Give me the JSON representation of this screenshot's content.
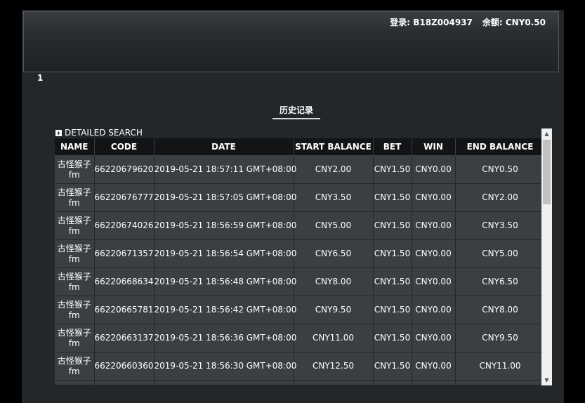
{
  "header": {
    "login_text": "登录: B18Z004937",
    "balance_text": "余额: CNY0.50"
  },
  "pagination": {
    "current_page": "1"
  },
  "tabs": [
    {
      "label": "历史记录"
    }
  ],
  "search": {
    "label": "DETAILED SEARCH"
  },
  "table": {
    "columns": [
      "NAME",
      "CODE",
      "DATE",
      "START BALANCE",
      "BET",
      "WIN",
      "END BALANCE"
    ],
    "rows": [
      {
        "name_line1": "古怪猴子",
        "name_line2": "fm",
        "code": "66220679620",
        "date": "2019-05-21 18:57:11 GMT+08:00",
        "start": "CNY2.00",
        "bet": "CNY1.50",
        "win": "CNY0.00",
        "end": "CNY0.50"
      },
      {
        "name_line1": "古怪猴子",
        "name_line2": "fm",
        "code": "66220676777",
        "date": "2019-05-21 18:57:05 GMT+08:00",
        "start": "CNY3.50",
        "bet": "CNY1.50",
        "win": "CNY0.00",
        "end": "CNY2.00"
      },
      {
        "name_line1": "古怪猴子",
        "name_line2": "fm",
        "code": "66220674026",
        "date": "2019-05-21 18:56:59 GMT+08:00",
        "start": "CNY5.00",
        "bet": "CNY1.50",
        "win": "CNY0.00",
        "end": "CNY3.50"
      },
      {
        "name_line1": "古怪猴子",
        "name_line2": "fm",
        "code": "66220671357",
        "date": "2019-05-21 18:56:54 GMT+08:00",
        "start": "CNY6.50",
        "bet": "CNY1.50",
        "win": "CNY0.00",
        "end": "CNY5.00"
      },
      {
        "name_line1": "古怪猴子",
        "name_line2": "fm",
        "code": "66220668634",
        "date": "2019-05-21 18:56:48 GMT+08:00",
        "start": "CNY8.00",
        "bet": "CNY1.50",
        "win": "CNY0.00",
        "end": "CNY6.50"
      },
      {
        "name_line1": "古怪猴子",
        "name_line2": "fm",
        "code": "66220665781",
        "date": "2019-05-21 18:56:42 GMT+08:00",
        "start": "CNY9.50",
        "bet": "CNY1.50",
        "win": "CNY0.00",
        "end": "CNY8.00"
      },
      {
        "name_line1": "古怪猴子",
        "name_line2": "fm",
        "code": "66220663137",
        "date": "2019-05-21 18:56:36 GMT+08:00",
        "start": "CNY11.00",
        "bet": "CNY1.50",
        "win": "CNY0.00",
        "end": "CNY9.50"
      },
      {
        "name_line1": "古怪猴子",
        "name_line2": "fm",
        "code": "66220660360",
        "date": "2019-05-21 18:56:30 GMT+08:00",
        "start": "CNY12.50",
        "bet": "CNY1.50",
        "win": "CNY0.00",
        "end": "CNY11.00"
      }
    ]
  },
  "scrollbar": {
    "up_icon": "chevron-up-icon",
    "down_icon": "chevron-down-icon"
  }
}
